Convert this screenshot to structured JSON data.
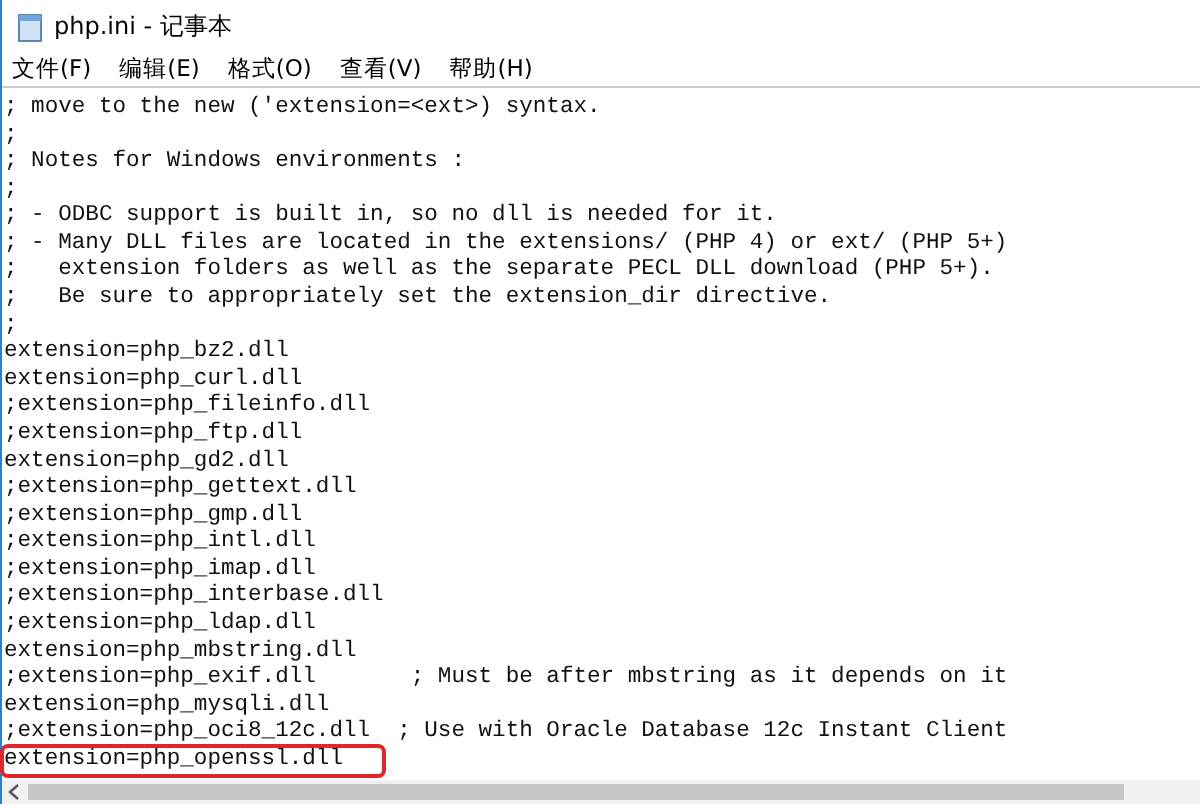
{
  "window": {
    "title": "php.ini - 记事本"
  },
  "menu": [
    "文件(F)",
    "编辑(E)",
    "格式(O)",
    "查看(V)",
    "帮助(H)"
  ],
  "editor": {
    "lines": [
      {
        "text": "; move to the new ('extension=<ext>) syntax.",
        "highlighted": false
      },
      {
        "text": ";",
        "highlighted": false
      },
      {
        "text": "; Notes for Windows environments :",
        "highlighted": false
      },
      {
        "text": ";",
        "highlighted": false
      },
      {
        "text": "; - ODBC support is built in, so no dll is needed for it.",
        "highlighted": false
      },
      {
        "text": "; - Many DLL files are located in the extensions/ (PHP 4) or ext/ (PHP 5+)",
        "highlighted": false
      },
      {
        "text": ";   extension folders as well as the separate PECL DLL download (PHP 5+).",
        "highlighted": false
      },
      {
        "text": ";   Be sure to appropriately set the extension_dir directive.",
        "highlighted": false
      },
      {
        "text": ";",
        "highlighted": false
      },
      {
        "text": "extension=php_bz2.dll",
        "highlighted": false
      },
      {
        "text": "extension=php_curl.dll",
        "highlighted": false
      },
      {
        "text": ";extension=php_fileinfo.dll",
        "highlighted": false
      },
      {
        "text": ";extension=php_ftp.dll",
        "highlighted": false
      },
      {
        "text": "extension=php_gd2.dll",
        "highlighted": false
      },
      {
        "text": ";extension=php_gettext.dll",
        "highlighted": false
      },
      {
        "text": ";extension=php_gmp.dll",
        "highlighted": false
      },
      {
        "text": ";extension=php_intl.dll",
        "highlighted": false
      },
      {
        "text": ";extension=php_imap.dll",
        "highlighted": false
      },
      {
        "text": ";extension=php_interbase.dll",
        "highlighted": false
      },
      {
        "text": ";extension=php_ldap.dll",
        "highlighted": false
      },
      {
        "text": "extension=php_mbstring.dll",
        "highlighted": false
      },
      {
        "text": ";extension=php_exif.dll       ; Must be after mbstring as it depends on it",
        "highlighted": false
      },
      {
        "text": "extension=php_mysqli.dll",
        "highlighted": false
      },
      {
        "text": ";extension=php_oci8_12c.dll  ; Use with Oracle Database 12c Instant Client",
        "highlighted": false
      },
      {
        "text": "extension=php_openssl.dll",
        "highlighted": true
      }
    ]
  }
}
